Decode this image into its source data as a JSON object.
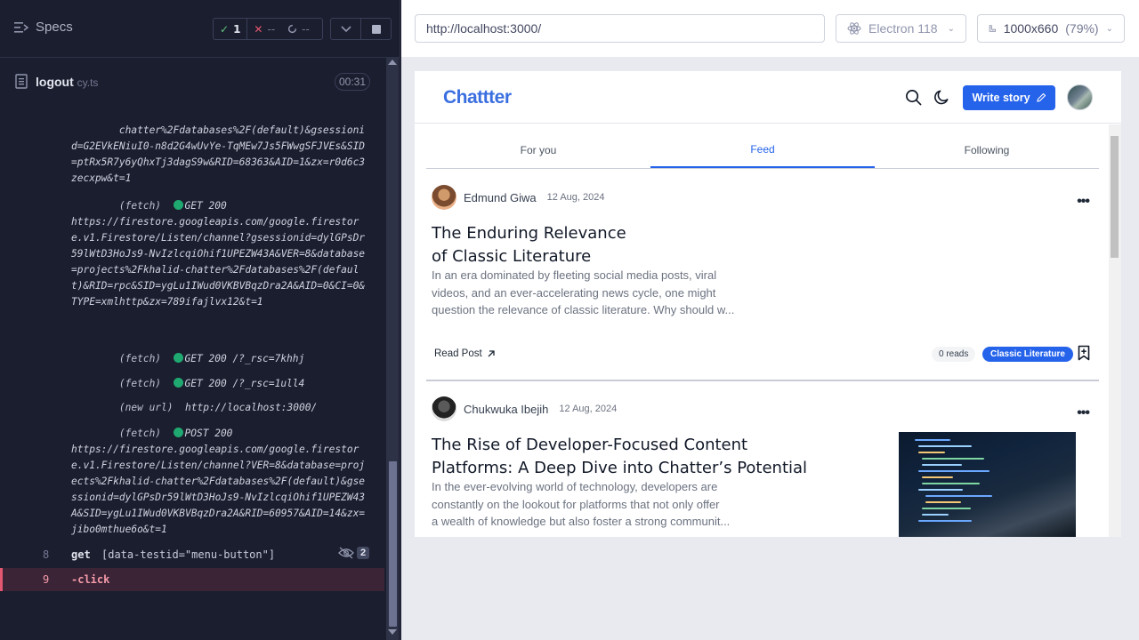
{
  "reporter": {
    "specs_label": "Specs",
    "stats": {
      "passed": "1",
      "failed": "--",
      "pending": "--"
    },
    "spec": {
      "name": "logout",
      "ext": "cy.ts",
      "duration": "00:31"
    },
    "log_entries": [
      {
        "kind": "",
        "method": "",
        "text": "chatter%2Fdatabases%2F(default)&gsessionid=G2EVkENiuI0-n8d2G4wUvYe-TqMEw7Js5FWwgSFJVEs&SID=ptRx5R7y6yQhxTj3dagS9w&RID=68363&AID=1&zx=r0d6c3zecxpw&t=1"
      },
      {
        "kind": "(fetch)",
        "method": "GET 200",
        "text": "https://firestore.googleapis.com/google.firestore.v1.Firestore/Listen/channel?gsessionid=dylGPsDr59lWtD3HoJs9-NvIzlcqiOhif1UPEZW43A&VER=8&database=projects%2Fkhalid-chatter%2Fdatabases%2F(default)&RID=rpc&SID=ygLu1IWud0VKBVBqzDra2A&AID=0&CI=0&TYPE=xmlhttp&zx=789ifajlvx12&t=1"
      },
      {
        "kind": "(fetch)",
        "method": "GET 200",
        "text": "/?_rsc=7khhj"
      },
      {
        "kind": "(fetch)",
        "method": "GET 200",
        "text": "/?_rsc=1ull4"
      },
      {
        "kind": "(new url)",
        "method": "",
        "text": "http://localhost:3000/"
      },
      {
        "kind": "(fetch)",
        "method": "POST 200",
        "text": "https://firestore.googleapis.com/google.firestore.v1.Firestore/Listen/channel?VER=8&database=projects%2Fkhalid-chatter%2Fdatabases%2F(default)&gsessionid=dylGPsDr59lWtD3HoJs9-NvIzlcqiOhif1UPEZW43A&SID=ygLu1IWud0VKBVBqzDra2A&RID=60957&AID=14&zx=jibo0mthue6o&t=1"
      }
    ],
    "commands": [
      {
        "num": "8",
        "name": "get",
        "message": "[data-testid=\"menu-button\"]",
        "hidden_count": "2"
      },
      {
        "num": "9",
        "name": "-click",
        "message": ""
      }
    ]
  },
  "aut": {
    "url": "http://localhost:3000/",
    "browser": "Electron 118",
    "viewport": "1000x660",
    "scale": "(79%)"
  },
  "app": {
    "logo": "Chattter",
    "write_story": "Write story",
    "tabs": [
      "For you",
      "Feed",
      "Following"
    ],
    "active_tab": "Feed",
    "posts": [
      {
        "author": "Edmund Giwa",
        "date": "12 Aug, 2024",
        "title_lines": [
          "The Enduring Relevance",
          "of Classic Literature"
        ],
        "excerpt_lines": [
          "In an era dominated by fleeting social media posts, viral",
          "videos, and an ever-accelerating news cycle, one might",
          "question the relevance of classic literature. Why should w..."
        ],
        "read_label": "Read Post",
        "reads": "0 reads",
        "category": "Classic Literature"
      },
      {
        "author": "Chukwuka Ibejih",
        "date": "12 Aug, 2024",
        "title_lines": [
          "The Rise of Developer-Focused Content",
          "Platforms: A Deep Dive into Chatter’s Potential"
        ],
        "excerpt_lines": [
          "In the ever-evolving world of technology, developers are",
          "constantly on the lookout for platforms that not only offer",
          "a wealth of knowledge but also foster a strong communit..."
        ]
      }
    ]
  }
}
